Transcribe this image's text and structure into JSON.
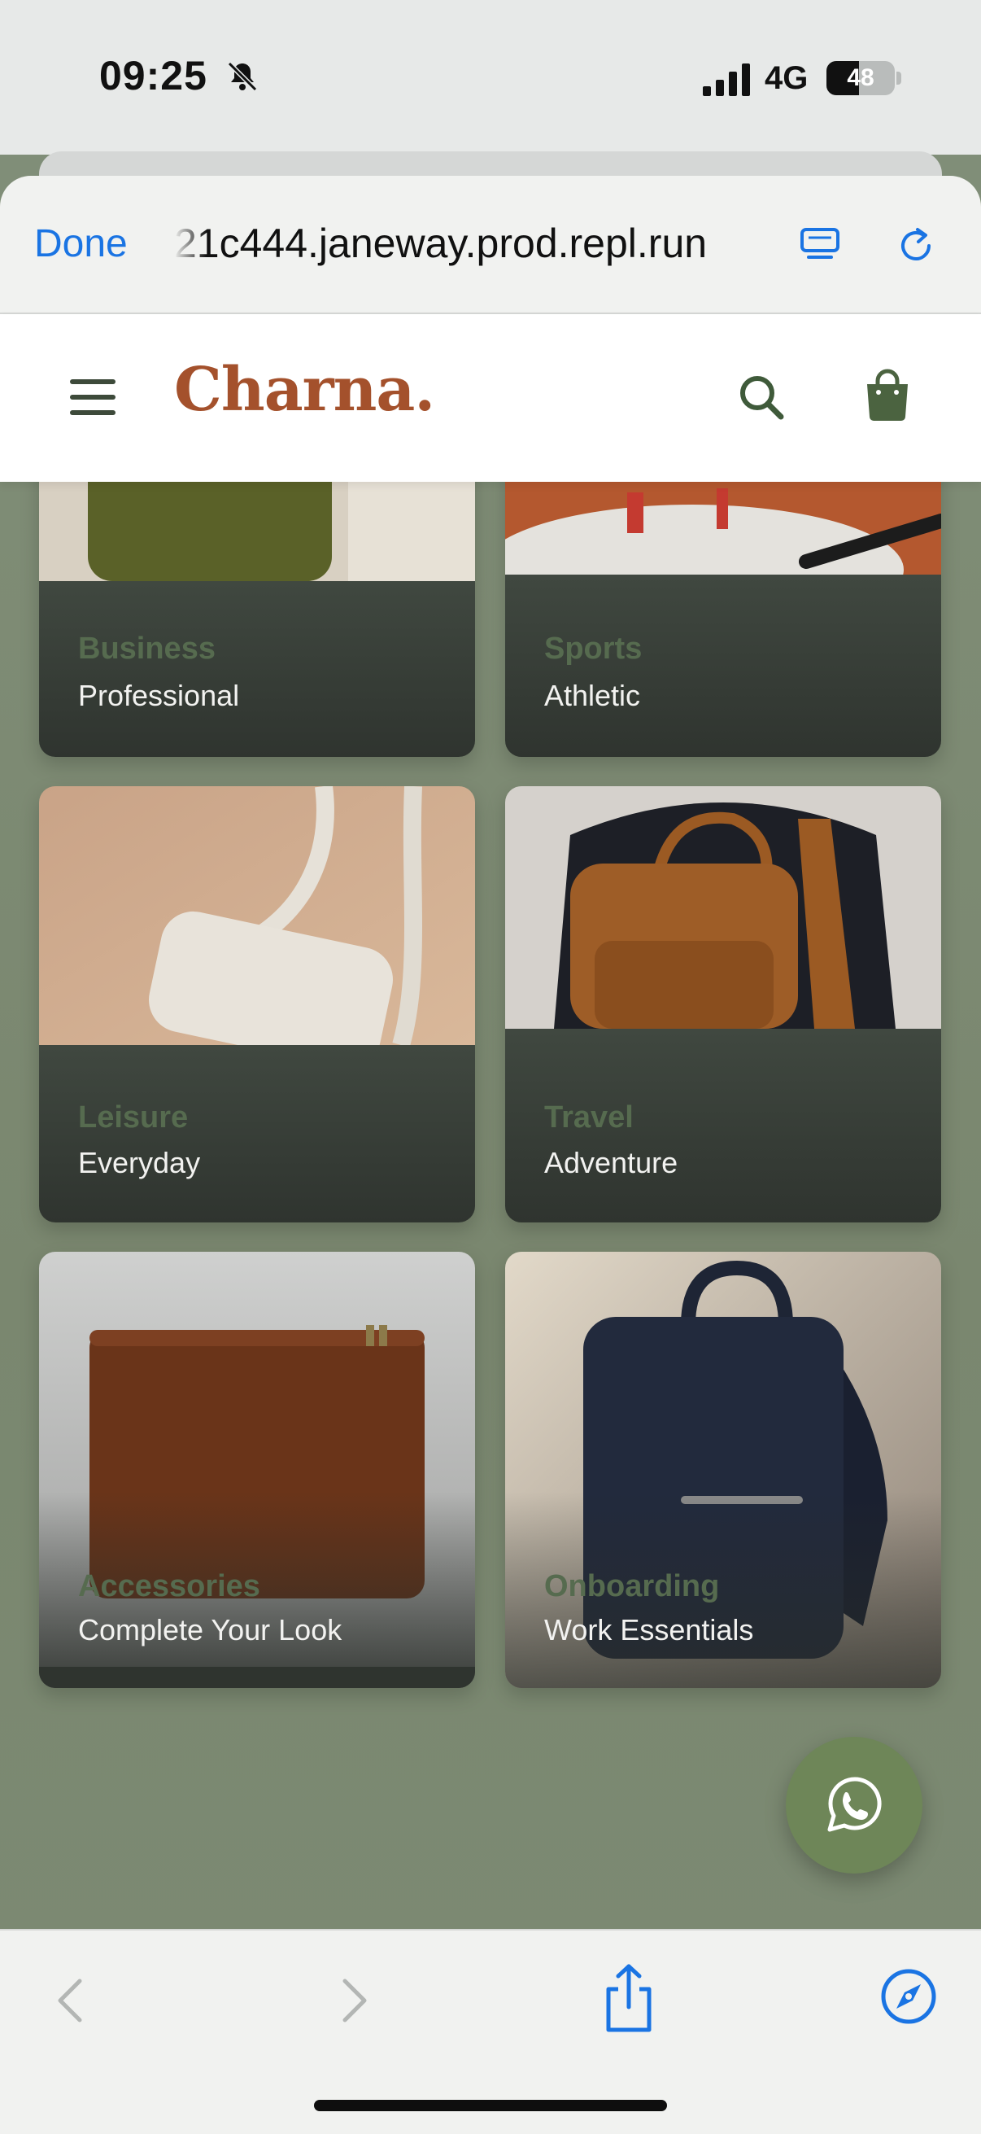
{
  "status_bar": {
    "time": "09:25",
    "network": "4G",
    "battery": "48",
    "battery_level": 0.48,
    "icons": [
      "bell-slash-icon",
      "signal-icon",
      "battery-icon"
    ]
  },
  "browser": {
    "done_label": "Done",
    "url": "21c444.janeway.prod.repl.run",
    "accent": "#1a74e3",
    "icons": [
      "tabs-icon",
      "reload-icon"
    ]
  },
  "site": {
    "logo": "Charna.",
    "logo_color": "#a4512c",
    "icons": [
      "menu-icon",
      "search-icon",
      "shopping-bag-icon"
    ]
  },
  "cards": [
    {
      "category": "Business",
      "subtitle": "Professional",
      "image": "olive-backpack-photo"
    },
    {
      "category": "Sports",
      "subtitle": "Athletic",
      "image": "tennis-bag-photo"
    },
    {
      "category": "Leisure",
      "subtitle": "Everyday",
      "image": "cream-crossbody-photo"
    },
    {
      "category": "Travel",
      "subtitle": "Adventure",
      "image": "brown-leather-backpack-photo"
    },
    {
      "category": "Accessories",
      "subtitle": "Complete Your Look",
      "image": "brown-leather-sleeve-photo"
    },
    {
      "category": "Onboarding",
      "subtitle": "Work Essentials",
      "image": "navy-backpack-photo"
    }
  ],
  "fab": {
    "icon": "whatsapp-icon",
    "color": "#6e8658"
  },
  "toolbar": {
    "icons": [
      "back-icon",
      "forward-icon",
      "share-icon",
      "compass-icon"
    ]
  }
}
